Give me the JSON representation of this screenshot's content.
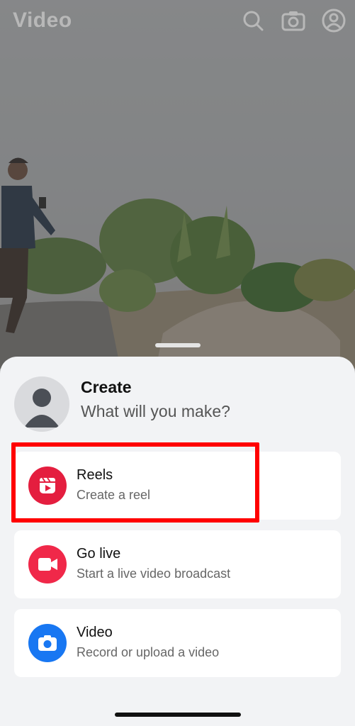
{
  "header": {
    "title": "Video",
    "icons": [
      "search-icon",
      "camera-icon",
      "profile-icon"
    ]
  },
  "sheet": {
    "title": "Create",
    "subtitle": "What will you make?",
    "options": [
      {
        "label": "Reels",
        "description": "Create a reel",
        "icon": "reels-icon",
        "color": "#e41e3f"
      },
      {
        "label": "Go live",
        "description": "Start a live video broadcast",
        "icon": "live-video-icon",
        "color": "#f02849"
      },
      {
        "label": "Video",
        "description": "Record or upload a video",
        "icon": "camera-icon",
        "color": "#1877f2"
      }
    ]
  },
  "highlight_color": "#ff0000"
}
